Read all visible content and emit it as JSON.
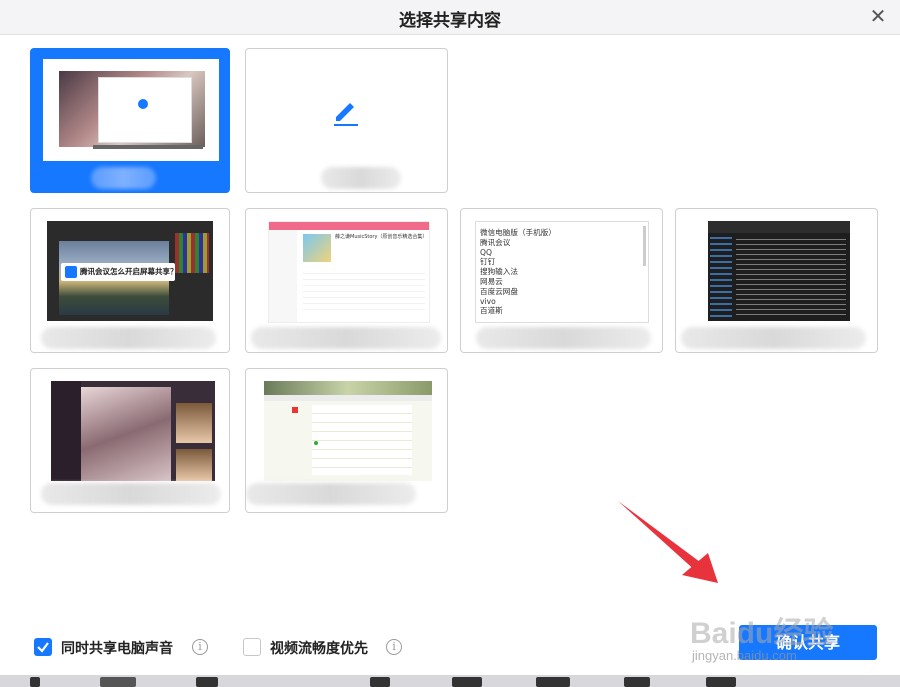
{
  "dialog": {
    "title": "选择共享内容",
    "close_icon": "close-icon"
  },
  "thumbnails": {
    "photoshop_overlay": "腾讯会议怎么开启屏幕共享？",
    "music_title": "薛之谦MusicStory（原创音乐精选合集）",
    "program_list": [
      "微信电脑版（手机版）",
      "腾讯会议",
      "QQ",
      "钉钉",
      "搜狗输入法",
      "网易云",
      "百度云网盘",
      "vivo",
      "百道斯"
    ]
  },
  "footer": {
    "share_audio_label": "同时共享电脑声音",
    "share_audio_checked": true,
    "video_smooth_label": "视频流畅度优先",
    "video_smooth_checked": false,
    "confirm_label": "确认共享"
  },
  "watermark": {
    "brand": "Baidu经验",
    "url": "jingyan.baidu.com"
  },
  "colors": {
    "accent": "#1677ff",
    "arrow": "#e8323c"
  }
}
